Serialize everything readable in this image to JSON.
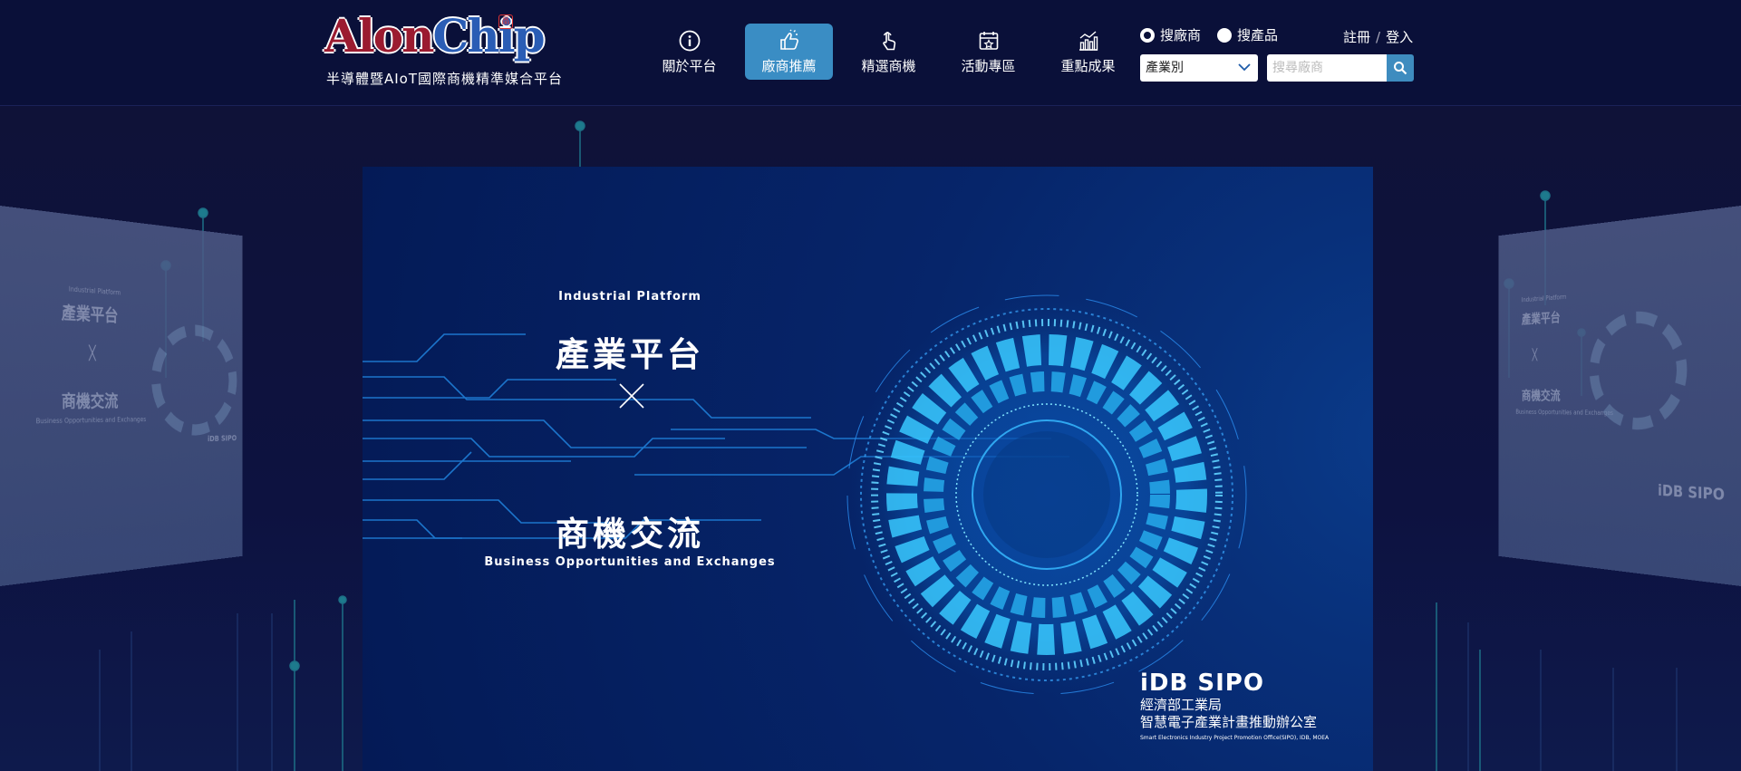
{
  "header": {
    "logo": {
      "part1": "Alon",
      "part2": "Chip",
      "badge": "晶"
    },
    "tagline": "半導體暨AIoT國際商機精準媒合平台",
    "nav": [
      {
        "label": "關於平台",
        "icon": "info-icon",
        "active": false
      },
      {
        "label": "廠商推薦",
        "icon": "thumbs-up-icon",
        "active": true
      },
      {
        "label": "精選商機",
        "icon": "tap-hand-icon",
        "active": false
      },
      {
        "label": "活動專區",
        "icon": "calendar-star-icon",
        "active": false
      },
      {
        "label": "重點成果",
        "icon": "bar-chart-icon",
        "active": false
      }
    ],
    "search": {
      "radio_vendor": "搜廠商",
      "radio_product": "搜產品",
      "selected": "搜廠商",
      "category_value": "產業別",
      "placeholder": "搜尋廠商"
    },
    "auth": {
      "register": "註冊",
      "separator": "/",
      "login": "登入"
    }
  },
  "banner": {
    "en_top": "Industrial Platform",
    "title1": "產業平台",
    "title2": "商機交流",
    "en_bottom": "Business Opportunities and Exchanges",
    "org_logo": "iDB SIPO",
    "org_line1": "經濟部工業局",
    "org_line2": "智慧電子產業計畫推動辦公室",
    "org_en": "Smart Electronics Industry Project Promotion Office(SIPO), IDB, MOEA"
  },
  "side_left": {
    "en_top": "Industrial Platform",
    "title1": "產業平台",
    "title2": "商機交流",
    "en_bottom": "Business Opportunities and Exchanges",
    "org_logo": "iDB SIPO"
  },
  "side_right": {
    "en_top": "Industrial Platform",
    "title1": "產業平台",
    "title2": "商機交流",
    "en_bottom": "Business Opportunities and Exchanges",
    "org_logo": "iDB SIPO"
  },
  "colors": {
    "header_bg": "#0a1039",
    "nav_active": "#3a8dc4",
    "logo_red": "#9b1b30",
    "logo_blue": "#2a5db5",
    "search_button": "#3e8cbf"
  }
}
